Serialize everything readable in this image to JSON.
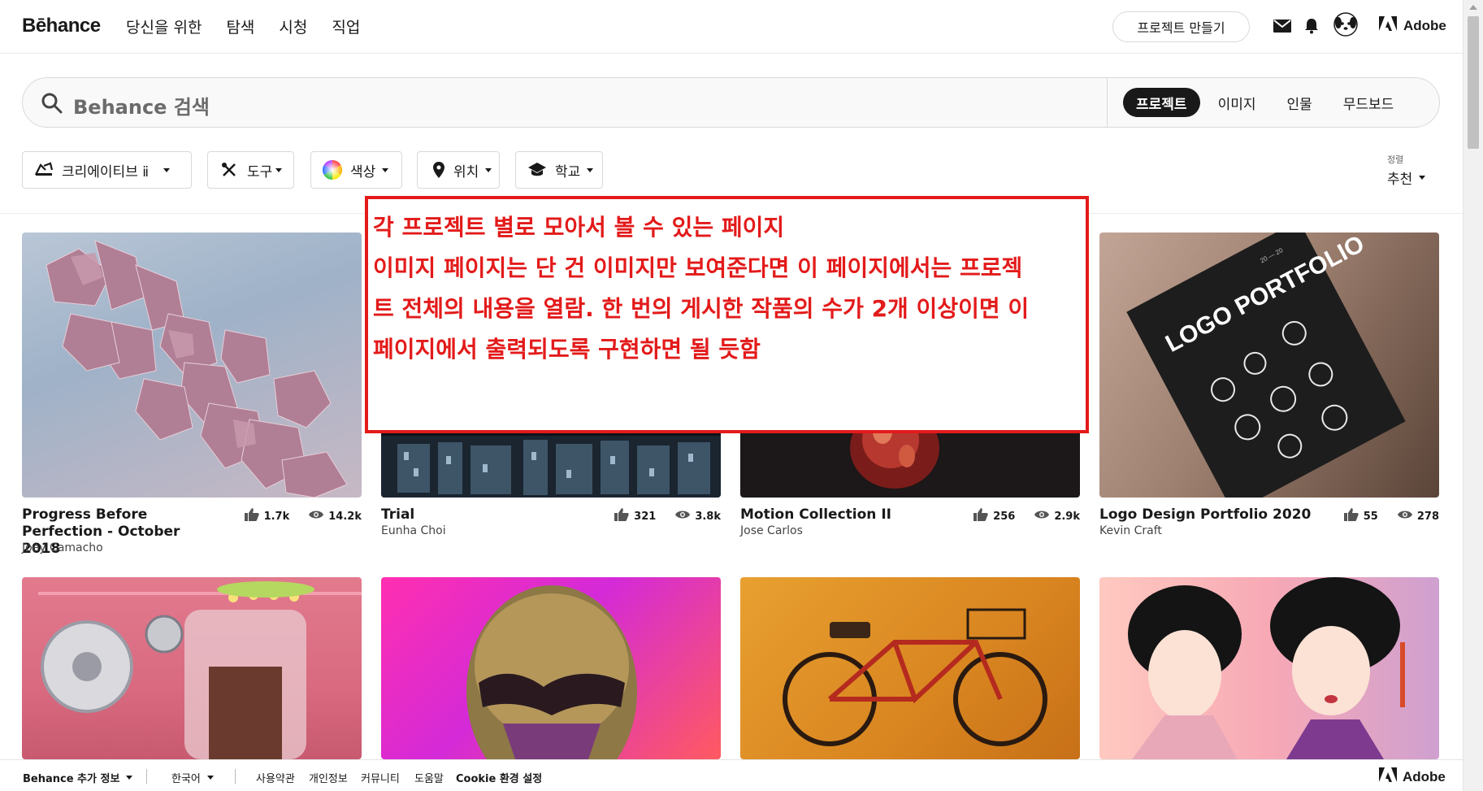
{
  "nav": {
    "logo": "Bēhance",
    "links": [
      "당신을 위한",
      "탐색",
      "시청",
      "직업"
    ],
    "create_project": "프로젝트 만들기",
    "adobe": "Adobe"
  },
  "search": {
    "placeholder": "Behance 검색",
    "tabs": [
      "프로젝트",
      "이미지",
      "인물",
      "무드보드"
    ],
    "active_tab": "프로젝트"
  },
  "filters": [
    "크리에이티브 ⅱ",
    "도구",
    "색상",
    "위치",
    "학교"
  ],
  "sort": {
    "label": "정렬",
    "value": "추천"
  },
  "projects": [
    {
      "title": "Progress Before Perfection - October 2018",
      "owner": "Joey Camacho",
      "likes": "1.7k",
      "views": "14.2k"
    },
    {
      "title": "Trial",
      "owner": "Eunha Choi",
      "likes": "321",
      "views": "3.8k"
    },
    {
      "title": "Motion Collection II",
      "owner": "Jose Carlos",
      "likes": "256",
      "views": "2.9k"
    },
    {
      "title": "Logo Design Portfolio 2020",
      "owner": "Kevin Craft",
      "likes": "55",
      "views": "278"
    }
  ],
  "logo_poster": {
    "text": "LOGO PORTFOLIO",
    "year": "20 — 20"
  },
  "annotation": {
    "lines": [
      "각 프로젝트 별로 모아서 볼 수 있는 페이지",
      "이미지 페이지는 단 건 이미지만 보여준다면 이 페이지에서는 프로젝",
      "트 전체의 내용을 열람. 한 번의 게시한 작품의 수가 2개 이상이면 이",
      "페이지에서 출력되도록 구현하면 될 듯함"
    ]
  },
  "footer": {
    "more_info": "Behance 추가 정보",
    "language": "한국어",
    "links": [
      "사용약관",
      "개인정보",
      "커뮤니티",
      "도움말",
      "Cookie 환경 설정"
    ],
    "adobe": "Adobe"
  },
  "colors": {
    "annotation_red": "#e31a1a",
    "active_tab_bg": "#191919"
  }
}
